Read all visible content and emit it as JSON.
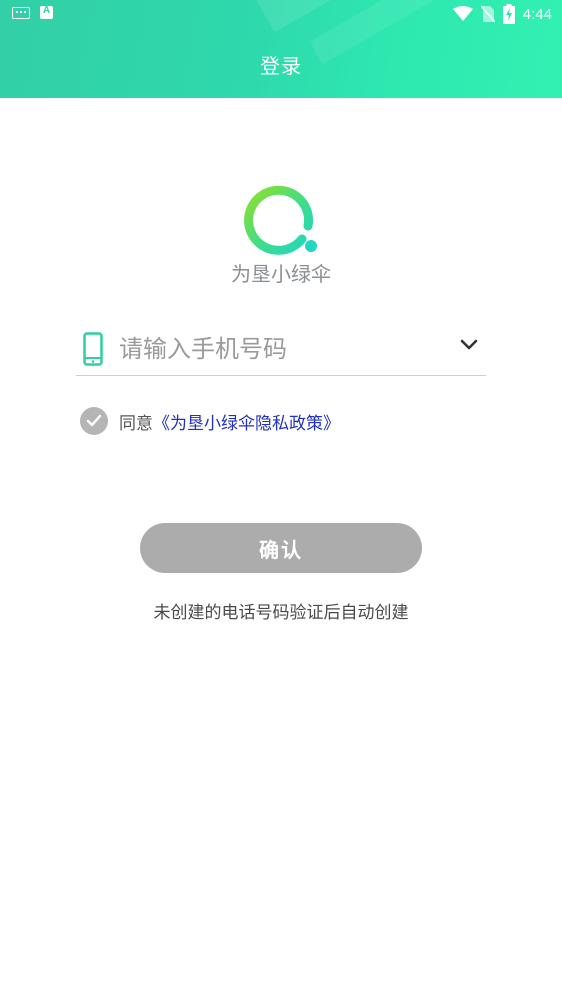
{
  "status_bar": {
    "time": "4:44",
    "left_icons": [
      "keyboard-icon",
      "font-a-icon"
    ],
    "right_icons": [
      "wifi-icon",
      "no-sim-icon",
      "battery-charging-icon"
    ]
  },
  "header": {
    "title": "登录",
    "gradient_colors": [
      "#33cfa6",
      "#33f0b2"
    ]
  },
  "logo": {
    "brand_name": "为垦小绿伞",
    "ring_colors": [
      "#8fe02a",
      "#22d6c0"
    ]
  },
  "phone_field": {
    "placeholder": "请输入手机号码",
    "value": "",
    "icon": "mobile-phone-icon",
    "dropdown_icon": "chevron-down-icon"
  },
  "agreement": {
    "agree_label": "同意",
    "policy_link": "《为垦小绿伞隐私政策》",
    "checked": true
  },
  "confirm_button": {
    "label": "确认",
    "enabled": false
  },
  "hint": "未创建的电话号码验证后自动创建"
}
